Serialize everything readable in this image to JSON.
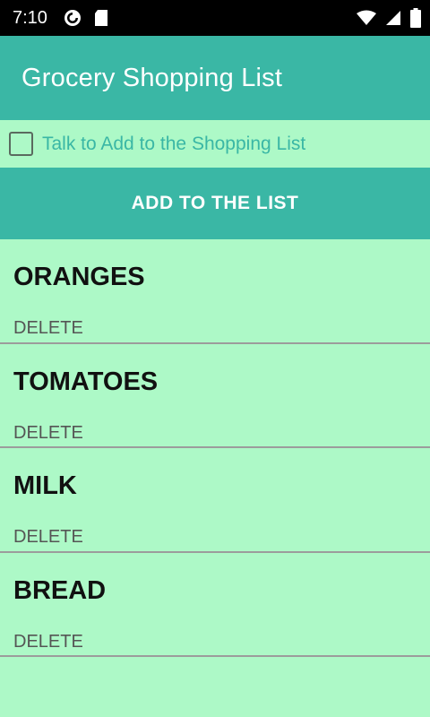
{
  "status_bar": {
    "time": "7:10",
    "left_icons": [
      "pocket-casts-icon",
      "sd-card-icon"
    ],
    "right_icons": [
      "wifi-icon",
      "signal-icon",
      "battery-icon"
    ]
  },
  "app_bar": {
    "title": "Grocery Shopping List"
  },
  "talk_option": {
    "label": "Talk to Add to the Shopping List",
    "checked": false
  },
  "add_button": {
    "label": "ADD TO THE LIST"
  },
  "items": [
    {
      "name": "ORANGES",
      "delete_label": "DELETE"
    },
    {
      "name": "TOMATOES",
      "delete_label": "DELETE"
    },
    {
      "name": "MILK",
      "delete_label": "DELETE"
    },
    {
      "name": "BREAD",
      "delete_label": "DELETE"
    }
  ],
  "colors": {
    "accent": "#3ab7a5",
    "background": "#adf9c7",
    "status_bar": "#000000",
    "divider": "#9c9c9c"
  }
}
